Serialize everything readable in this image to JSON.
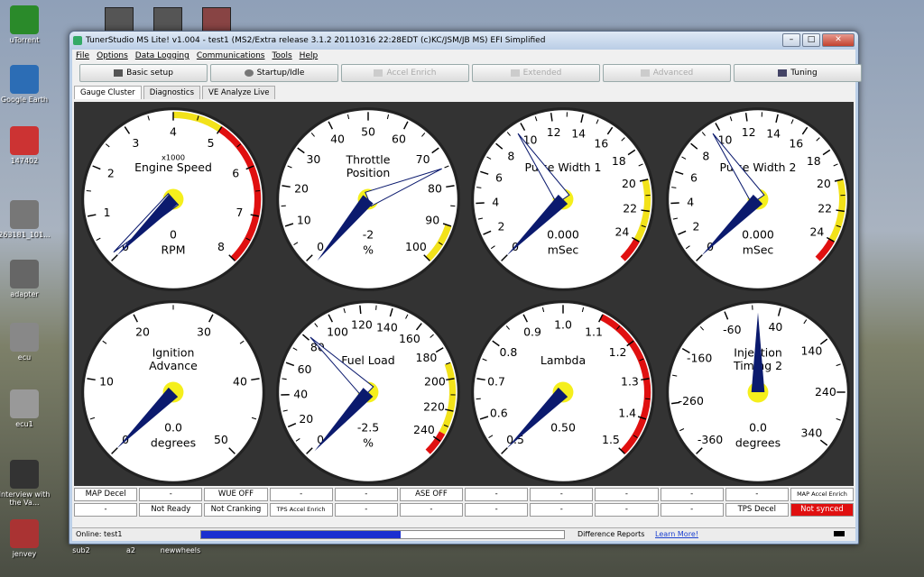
{
  "desktop": {
    "icons": [
      {
        "label": "uTorrent",
        "color": "#2a8a2a"
      },
      {
        "label": "Google Earth",
        "color": "#2c6db5"
      },
      {
        "label": "147402",
        "color": "#c33"
      },
      {
        "label": "263181_101...",
        "color": "#777"
      },
      {
        "label": "adapter",
        "color": "#666"
      },
      {
        "label": "ecu",
        "color": "#888"
      },
      {
        "label": "ecu1",
        "color": "#999"
      },
      {
        "label": "Interview with the Va...",
        "color": "#333"
      },
      {
        "label": "jenvey",
        "color": "#a33"
      }
    ],
    "bottom_labels": [
      "sub2",
      "a2",
      "newwheels"
    ]
  },
  "window": {
    "title": "TunerStudio MS Lite! v1.004 - test1 (MS2/Extra release 3.1.2 20110316 22:28EDT (c)KC/JSM/JB MS) EFI Simplified",
    "menu": [
      "File",
      "Options",
      "Data Logging",
      "Communications",
      "Tools",
      "Help"
    ],
    "toolbar": [
      {
        "label": "Basic setup",
        "enabled": true,
        "icon": "car-icon"
      },
      {
        "label": "Startup/Idle",
        "enabled": true,
        "icon": "key-icon"
      },
      {
        "label": "Accel Enrich",
        "enabled": false,
        "icon": "pedal-icon"
      },
      {
        "label": "Extended",
        "enabled": false,
        "icon": "tool-icon"
      },
      {
        "label": "Advanced",
        "enabled": false,
        "icon": "wrench-icon"
      },
      {
        "label": "Tuning",
        "enabled": true,
        "icon": "tuning-icon"
      }
    ],
    "tabs": [
      "Gauge Cluster",
      "Diagnostics",
      "VE Analyze Live"
    ],
    "active_tab": "Gauge Cluster"
  },
  "gauges": [
    {
      "title1": "Engine Speed",
      "title2": "",
      "mult": "x1000",
      "value": "0",
      "units": "RPM",
      "min": 0,
      "max": 8,
      "labels": [
        "0",
        "1",
        "2",
        "3",
        "4",
        "5",
        "6",
        "7",
        "8"
      ],
      "current": 0,
      "yellow": [
        4,
        5
      ],
      "red": [
        5,
        8
      ],
      "peak": 0.1
    },
    {
      "title1": "Throttle",
      "title2": "Position",
      "mult": "",
      "value": "-2",
      "units": "%",
      "min": 0,
      "max": 100,
      "labels": [
        "0",
        "10",
        "20",
        "30",
        "40",
        "50",
        "60",
        "70",
        "80",
        "90",
        "100"
      ],
      "current": -2,
      "yellow": [
        90,
        100
      ],
      "red": null,
      "peak": 75
    },
    {
      "title1": "Pulse Width 1",
      "title2": "",
      "mult": "",
      "value": "0.000",
      "units": "mSec",
      "min": 0,
      "max": 25.5,
      "labels": [
        "0",
        "2",
        "4",
        "6",
        "8",
        "10",
        "12",
        "14",
        "16",
        "18",
        "20",
        "22",
        "24"
      ],
      "current": 0,
      "yellow": [
        20,
        24
      ],
      "red": [
        24,
        25.5
      ],
      "peak": 9.5
    },
    {
      "title1": "Pulse Width 2",
      "title2": "",
      "mult": "",
      "value": "0.000",
      "units": "mSec",
      "min": 0,
      "max": 25.5,
      "labels": [
        "0",
        "2",
        "4",
        "6",
        "8",
        "10",
        "12",
        "14",
        "16",
        "18",
        "20",
        "22",
        "24"
      ],
      "current": 0,
      "yellow": [
        20,
        24
      ],
      "red": [
        24,
        25.5
      ],
      "peak": 9.5
    },
    {
      "title1": "Ignition",
      "title2": "Advance",
      "mult": "",
      "value": "0.0",
      "units": "degrees",
      "min": 0,
      "max": 50,
      "labels": [
        "0",
        "10",
        "20",
        "30",
        "40",
        "50"
      ],
      "current": 0,
      "yellow": null,
      "red": null,
      "peak": null
    },
    {
      "title1": "Fuel Load",
      "title2": "",
      "mult": "",
      "value": "-2.5",
      "units": "%",
      "min": 0,
      "max": 250,
      "labels": [
        "0",
        "20",
        "40",
        "60",
        "80",
        "100",
        "120",
        "140",
        "160",
        "180",
        "200",
        "220",
        "240"
      ],
      "current": -2.5,
      "yellow": [
        190,
        235
      ],
      "red": [
        235,
        250
      ],
      "peak": 82
    },
    {
      "title1": "Lambda",
      "title2": "",
      "mult": "",
      "value": "0.50",
      "units": "",
      "min": 0.5,
      "max": 1.5,
      "labels": [
        "0.5",
        "0.6",
        "0.7",
        "0.8",
        "0.9",
        "1.0",
        "1.1",
        "1.2",
        "1.3",
        "1.4",
        "1.5"
      ],
      "current": 0.5,
      "yellow": null,
      "red": [
        1.1,
        1.5
      ],
      "peak": null
    },
    {
      "title1": "Injection",
      "title2": "Timing 2",
      "mult": "",
      "value": "0.0",
      "units": "degrees",
      "min": -360,
      "max": 360,
      "labels": [
        "-360",
        "-260",
        "-160",
        "-60",
        "40",
        "140",
        "240",
        "340"
      ],
      "current": 0,
      "yellow": null,
      "red": null,
      "peak": null
    }
  ],
  "indicators": {
    "row1": [
      "MAP Decel",
      "-",
      "WUE OFF",
      "-",
      "-",
      "ASE OFF",
      "-",
      "-",
      "-",
      "-",
      "-",
      "MAP Accel Enrich"
    ],
    "row2": [
      "-",
      "Not Ready",
      "Not Cranking",
      "TPS Accel Enrich",
      "-",
      "-",
      "-",
      "-",
      "-",
      "-",
      "TPS Decel",
      "Not synced"
    ]
  },
  "statusbar": {
    "online": "Online: test1",
    "progress": 0.55,
    "diff": "Difference Reports",
    "learn": "Learn More!"
  },
  "colors": {
    "needle": "#0b1a6e",
    "yellow": "#f2e21a",
    "red": "#e01010",
    "panel": "#333333"
  }
}
